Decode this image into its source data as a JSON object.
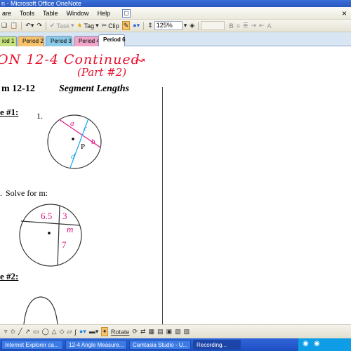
{
  "window": {
    "title": "n - Microsoft Office OneNote"
  },
  "menu": {
    "items": [
      "are",
      "Tools",
      "Table",
      "Window",
      "Help"
    ],
    "search_icon": "search-icon"
  },
  "toolbar": {
    "task_label": "Task",
    "tag_label": "Tag",
    "clip_label": "Clip",
    "zoom_value": "125%"
  },
  "tabs": {
    "items": [
      "iod 1",
      "Period 2",
      "Period 3",
      "Period 4",
      "Period 6"
    ],
    "active": "Period 6"
  },
  "annotations": {
    "title_ink": "ON 12-4 Continued",
    "subtitle_ink": "(Part #2)"
  },
  "worksheet": {
    "heading_left": "m 12-12",
    "heading_right": "Segment Lengths",
    "example1_label": "e #1:",
    "problem1_number": "1.",
    "circle1": {
      "a": "a",
      "b": "b",
      "c": "c",
      "d": "d",
      "p": "P"
    },
    "problem2_number": ".",
    "problem2_text": "Solve for m:",
    "circle2": {
      "seg1": "6.5",
      "seg2": "3",
      "seg3": "m",
      "seg4": "7"
    },
    "example2_label": "e #2:"
  },
  "drawing_toolbar": {
    "rotate_label": "Rotate"
  },
  "taskbar": {
    "items": [
      "Internet Explorer ca...",
      "12-4 Angle Measure...",
      "Camtasia Studio - U...",
      "Recording..."
    ],
    "active_index": 3
  },
  "colors": {
    "ink_red": "#e8112d",
    "chord_pink": "#e0127f",
    "chord_blue": "#1aa6e8",
    "taskbar_blue": "#2f65d9"
  }
}
